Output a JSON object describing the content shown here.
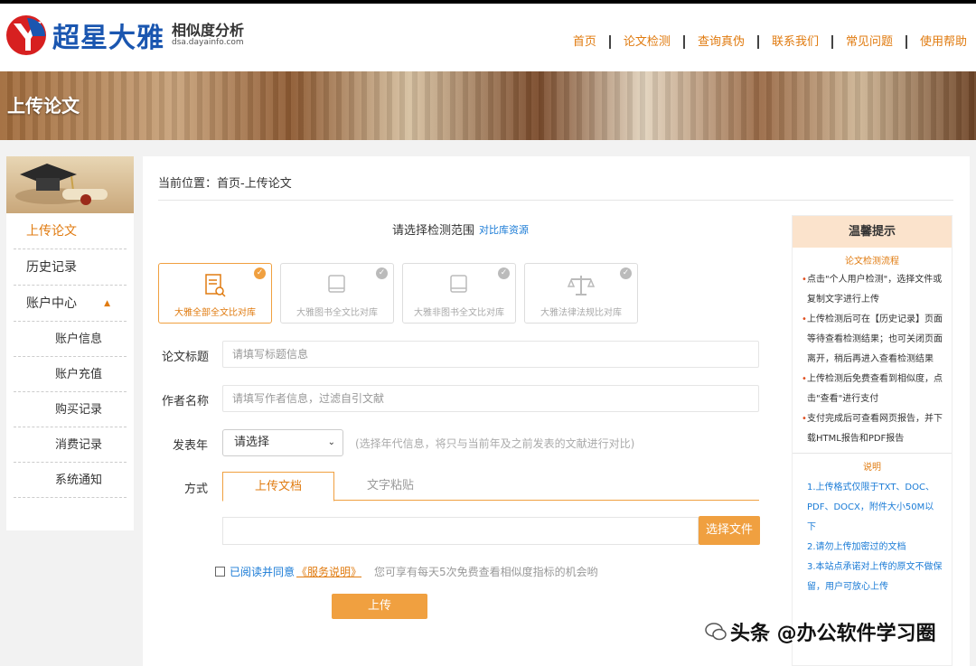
{
  "brand": {
    "name": "超星大雅",
    "subtitle": "相似度分析",
    "domain": "dsa.dayainfo.com",
    "colors": {
      "blue": "#1a56b0",
      "red": "#d72020",
      "accent": "#f0a040"
    }
  },
  "nav": [
    "首页",
    "论文检测",
    "查询真伪",
    "联系我们",
    "常见问题",
    "使用帮助"
  ],
  "banner": {
    "title": "上传论文"
  },
  "sidebar": {
    "items": [
      {
        "label": "上传论文"
      },
      {
        "label": "历史记录"
      },
      {
        "label": "账户中心"
      },
      {
        "label": "账户信息"
      },
      {
        "label": "账户充值"
      },
      {
        "label": "购买记录"
      },
      {
        "label": "消费记录"
      },
      {
        "label": "系统通知"
      }
    ]
  },
  "breadcrumb": "当前位置：首页-上传论文",
  "scope": {
    "title": "请选择检测范围",
    "link": "对比库资源",
    "cards": [
      {
        "label": "大雅全部全文比对库",
        "icon": "document-search-icon",
        "selected": true
      },
      {
        "label": "大雅图书全文比对库",
        "icon": "book-icon",
        "selected": false
      },
      {
        "label": "大雅非图书全文比对库",
        "icon": "book-icon",
        "selected": false
      },
      {
        "label": "大雅法律法规比对库",
        "icon": "scales-icon",
        "selected": false
      }
    ]
  },
  "form": {
    "title_label": "论文标题",
    "title_placeholder": "请填写标题信息",
    "author_label": "作者名称",
    "author_placeholder": "请填写作者信息，过滤自引文献",
    "year_label": "发表年",
    "year_value": "请选择",
    "year_hint": "(选择年代信息，将只与当前年及之前发表的文献进行对比)",
    "method_label": "方式",
    "tabs": [
      "上传文档",
      "文字粘贴"
    ],
    "choose_file": "选择文件",
    "agree_text": "已阅读并同意",
    "agree_link": "《服务说明》",
    "agree_hint": "您可享有每天5次免费查看相似度指标的机会哟",
    "upload_button": "上传"
  },
  "tips": {
    "title": "温馨提示",
    "flow_title": "论文检测流程",
    "flow": [
      "点击\"个人用户检测\"，选择文件或复制文字进行上传",
      "上传检测后可在【历史记录】页面等待查看检测结果；也可关闭页面离开，稍后再进入查看检测结果",
      "上传检测后免费查看到相似度，点击\"查看\"进行支付",
      "支付完成后可查看网页报告，并下载HTML报告和PDF报告"
    ],
    "note_title": "说明",
    "notes": [
      "1.上传格式仅限于TXT、DOC、PDF、DOCX，附件大小50M以下",
      "2.请勿上传加密过的文档",
      "3.本站点承诺对上传的原文不做保留，用户可放心上传"
    ]
  },
  "watermark": "头条 @办公软件学习圈"
}
